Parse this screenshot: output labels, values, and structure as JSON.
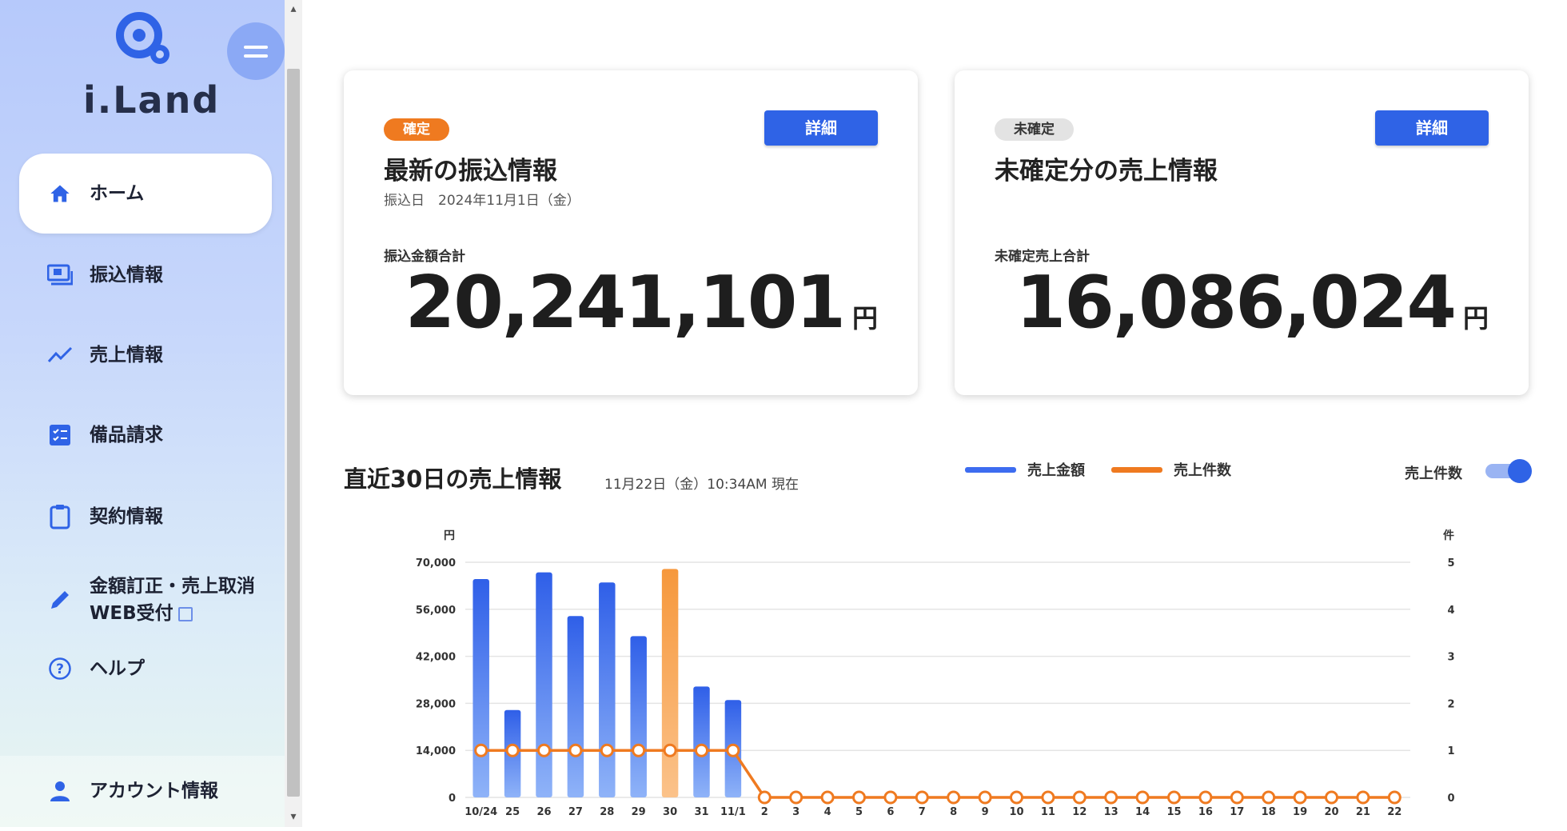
{
  "app": {
    "name": "i.Land"
  },
  "sidebar": {
    "items": [
      {
        "label": "ホーム",
        "icon": "home-icon",
        "active": true
      },
      {
        "label": "振込情報",
        "icon": "transfer-icon"
      },
      {
        "label": "売上情報",
        "icon": "trend-icon"
      },
      {
        "label": "備品請求",
        "icon": "checklist-icon"
      },
      {
        "label": "契約情報",
        "icon": "clipboard-icon"
      },
      {
        "label": "金額訂正・売上取消",
        "label2": "WEB受付",
        "icon": "pencil-icon"
      },
      {
        "label": "ヘルプ",
        "icon": "help-icon"
      }
    ],
    "account_label": "アカウント情報"
  },
  "cards": [
    {
      "badge": "確定",
      "detail_label": "詳細",
      "title": "最新の振込情報",
      "subtitle": "振込日　2024年11月1日（金）",
      "total_label": "振込金額合計",
      "amount": "20,241,101",
      "unit": "円"
    },
    {
      "badge": "未確定",
      "detail_label": "詳細",
      "title": "未確定分の売上情報",
      "subtitle": "",
      "total_label": "未確定売上合計",
      "amount": "16,086,024",
      "unit": "円"
    }
  ],
  "chart_section": {
    "title": "直近30日の売上情報",
    "subtitle": "11月22日（金）10:34AM 現在",
    "toggle_label": "売上件数",
    "toggle_on": true
  },
  "colors": {
    "bar": "#3d6cf0",
    "bar_highlight": "#f7a24e",
    "line": "#ef7a20",
    "accent": "#2f63e6"
  },
  "chart_data": {
    "type": "bar",
    "categories": [
      "10/24",
      "25",
      "26",
      "27",
      "28",
      "29",
      "30",
      "31",
      "11/1",
      "2",
      "3",
      "4",
      "5",
      "6",
      "7",
      "8",
      "9",
      "10",
      "11",
      "12",
      "13",
      "14",
      "15",
      "16",
      "17",
      "18",
      "19",
      "20",
      "21",
      "22"
    ],
    "series": [
      {
        "name": "売上金額",
        "type": "bar",
        "axis": "left",
        "values": [
          65000,
          26000,
          67000,
          54000,
          64000,
          48000,
          68000,
          33000,
          29000,
          0,
          0,
          0,
          0,
          0,
          0,
          0,
          0,
          0,
          0,
          0,
          0,
          0,
          0,
          0,
          0,
          0,
          0,
          0,
          0,
          0
        ],
        "highlight_index": 6
      },
      {
        "name": "売上件数",
        "type": "line",
        "axis": "right",
        "values": [
          1,
          1,
          1,
          1,
          1,
          1,
          1,
          1,
          1,
          0,
          0,
          0,
          0,
          0,
          0,
          0,
          0,
          0,
          0,
          0,
          0,
          0,
          0,
          0,
          0,
          0,
          0,
          0,
          0,
          0
        ]
      }
    ],
    "y_left": {
      "unit": "円",
      "range": [
        0,
        70000
      ],
      "ticks": [
        "0",
        "14,000",
        "28,000",
        "42,000",
        "56,000",
        "70,000"
      ]
    },
    "y_right": {
      "unit": "件",
      "range": [
        0,
        5
      ],
      "ticks": [
        "0",
        "1",
        "2",
        "3",
        "4",
        "5"
      ]
    },
    "grid": true,
    "legend_position": "top-right"
  }
}
